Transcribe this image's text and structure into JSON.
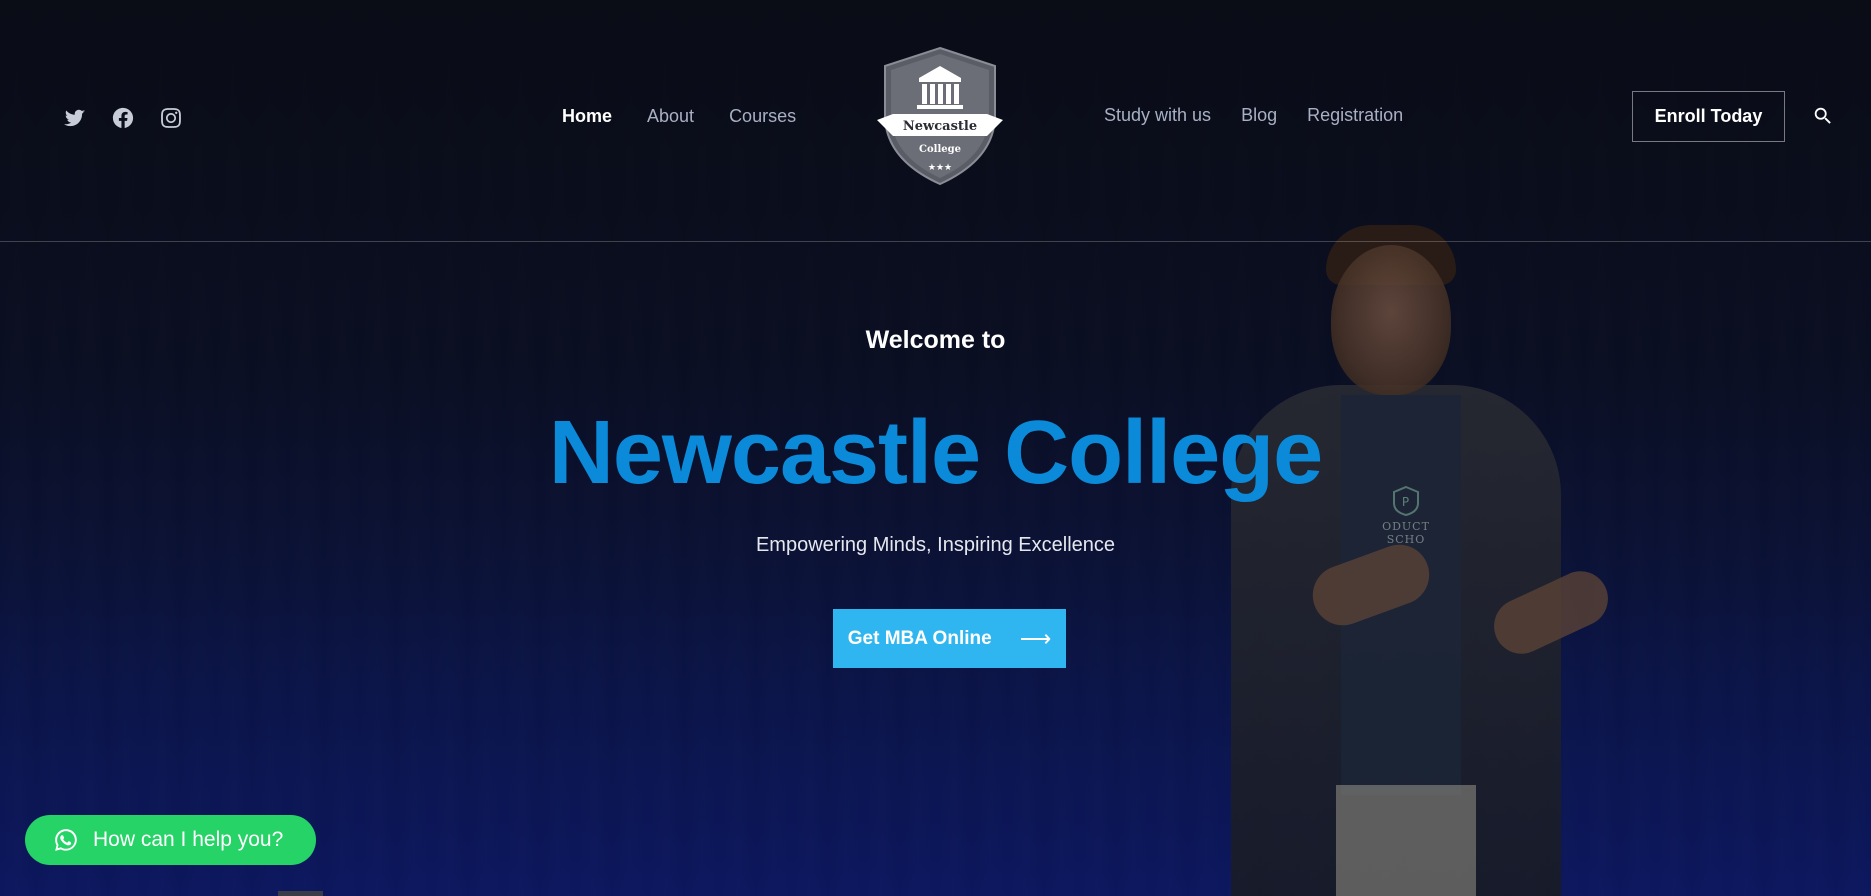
{
  "header": {
    "social_icons": [
      "twitter-icon",
      "facebook-icon",
      "instagram-icon"
    ],
    "nav_left": [
      {
        "label": "Home",
        "active": true
      },
      {
        "label": "About",
        "active": false
      },
      {
        "label": "Courses",
        "active": false
      }
    ],
    "nav_right": [
      {
        "label": "Study with us"
      },
      {
        "label": "Blog"
      },
      {
        "label": "Registration"
      }
    ],
    "logo": {
      "line1": "Newcastle",
      "line2": "College"
    },
    "enroll_label": "Enroll Today",
    "search_icon": "search-icon"
  },
  "hero": {
    "welcome": "Welcome to",
    "title": "Newcastle College",
    "tagline": "Empowering Minds, Inspiring Excellence",
    "cta_label": "Get MBA Online",
    "cta_arrow": "⟶",
    "shirt_text": "ODUCT SCHO"
  },
  "chat": {
    "label": "How can I help you?"
  },
  "colors": {
    "title": "#0a8ad9",
    "cta": "#2fb6f0",
    "chat": "#25d366"
  }
}
